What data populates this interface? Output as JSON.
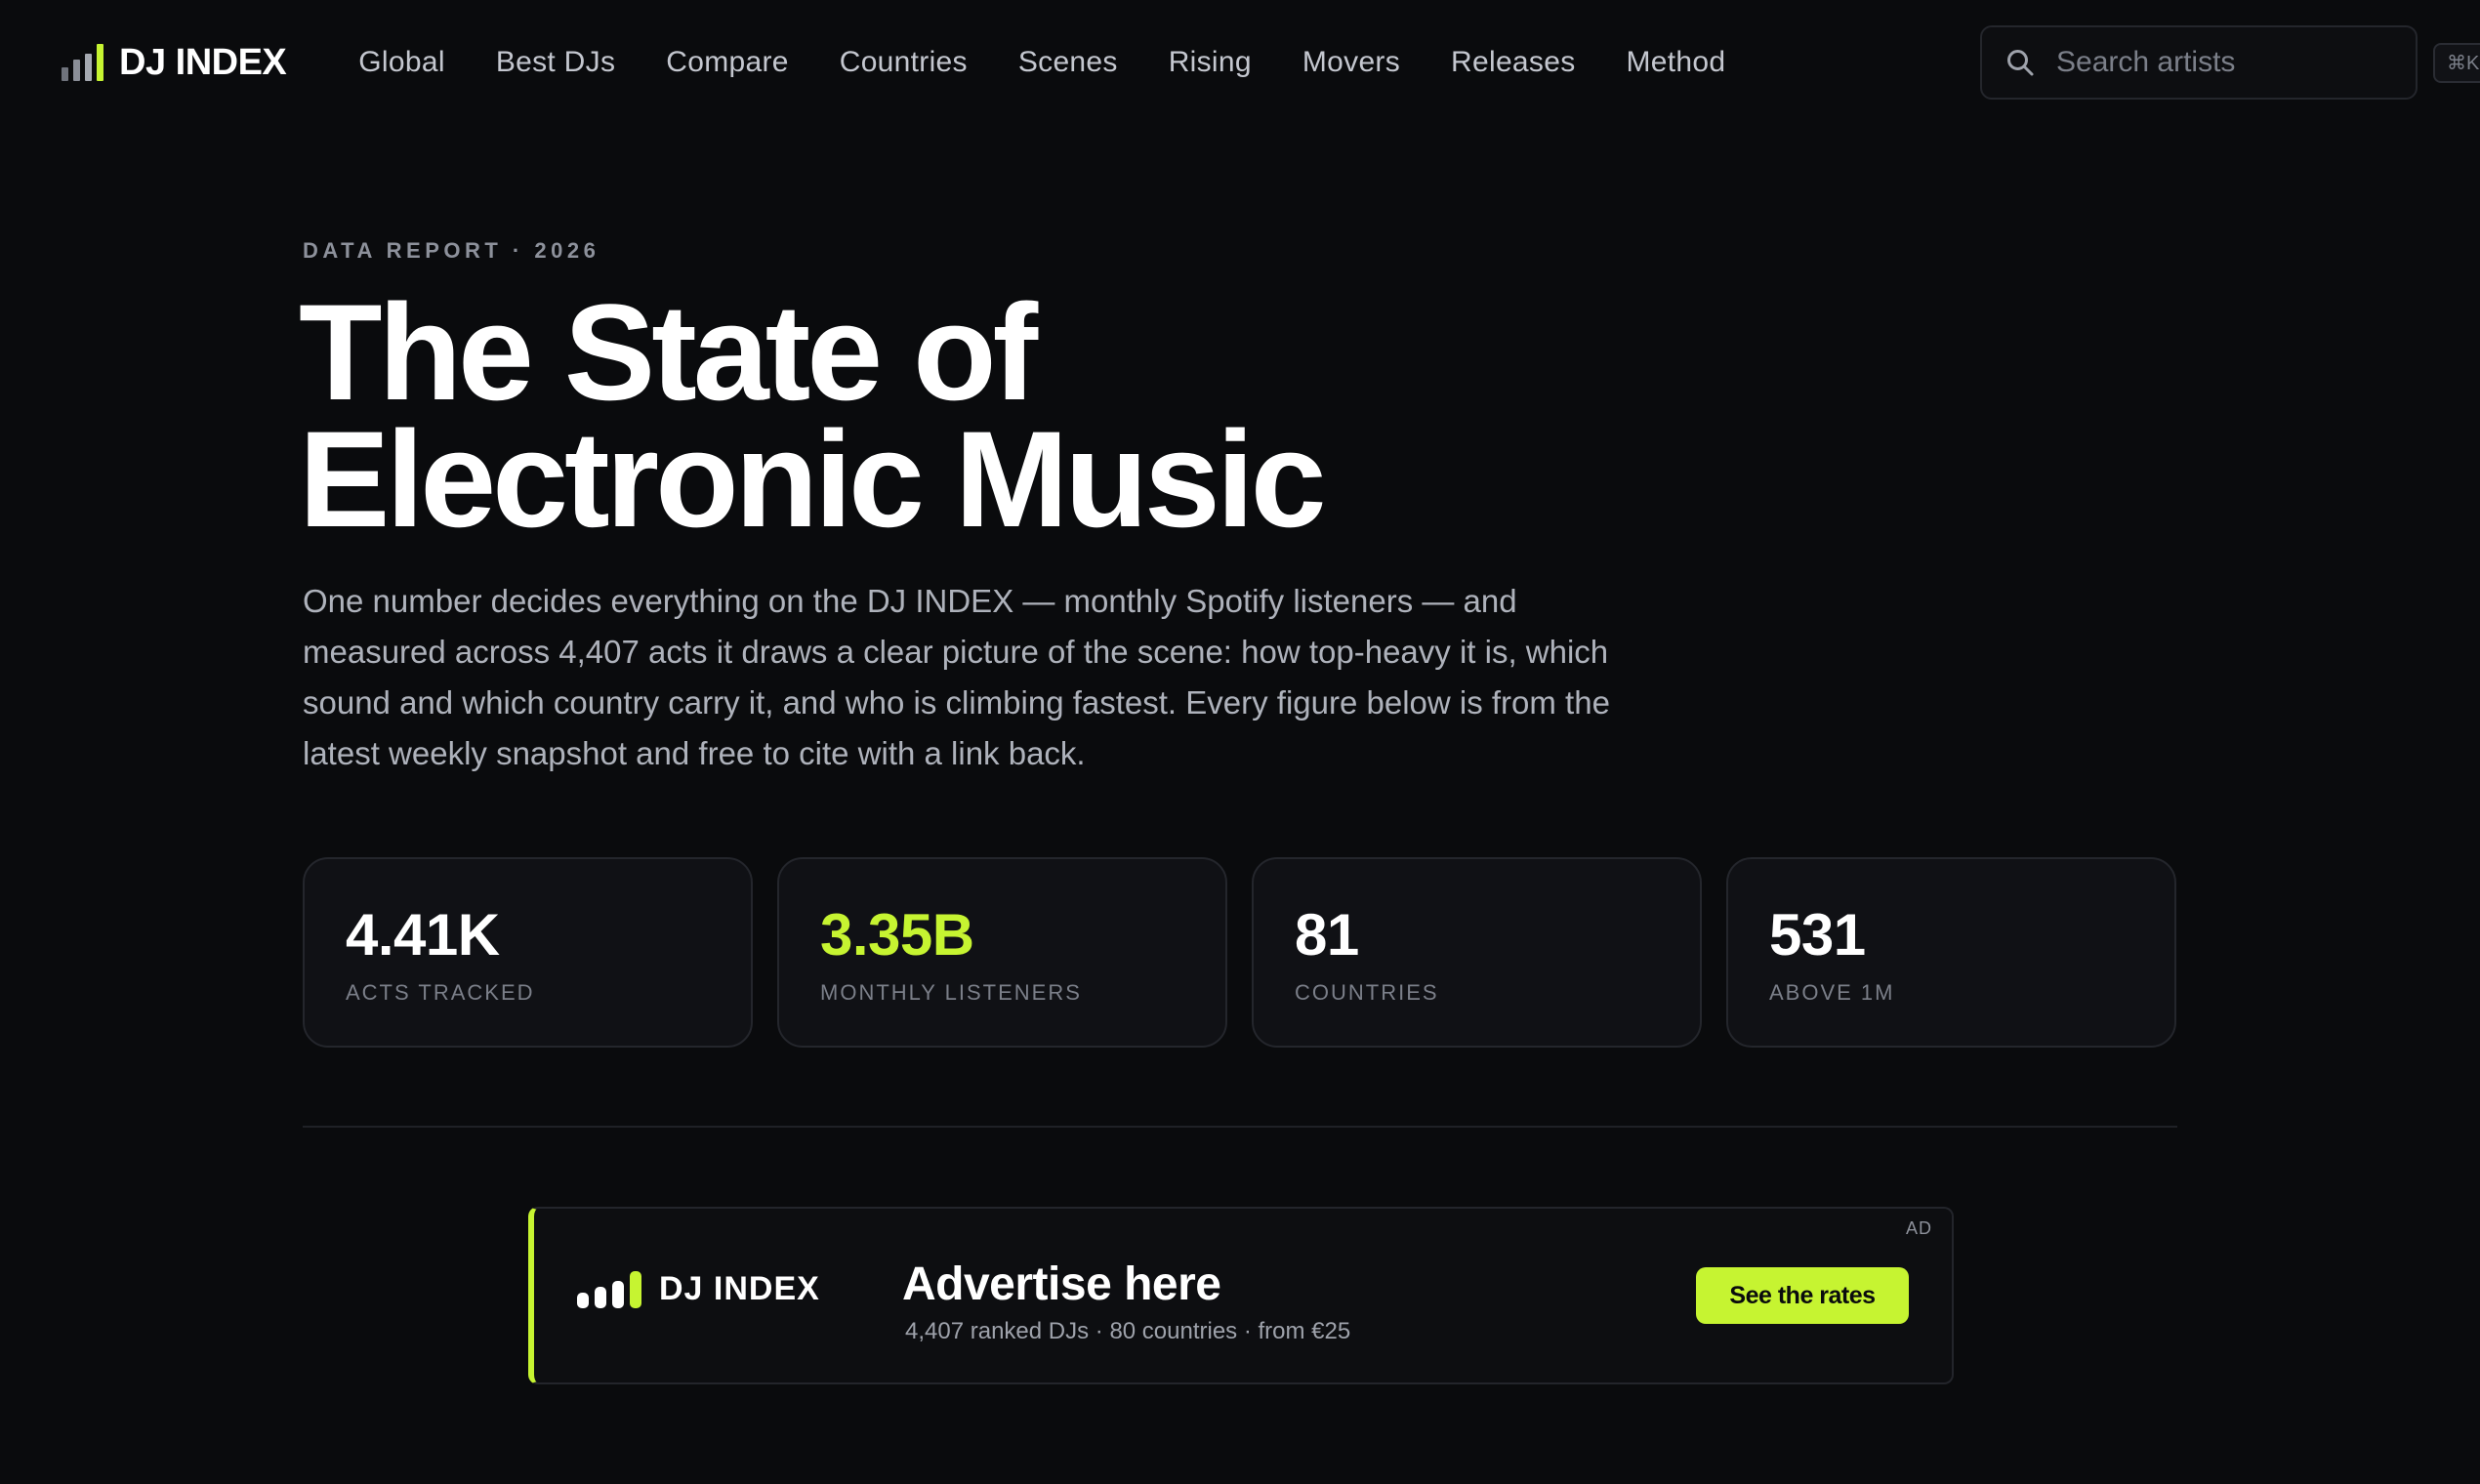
{
  "brand": {
    "name": "DJ INDEX",
    "accent_color": "#c6f431",
    "logo_icon": "bar-chart-icon"
  },
  "nav": {
    "items": [
      {
        "label": "Global"
      },
      {
        "label": "Best DJs"
      },
      {
        "label": "Compare"
      },
      {
        "label": "Countries"
      },
      {
        "label": "Scenes"
      },
      {
        "label": "Rising"
      },
      {
        "label": "Movers"
      },
      {
        "label": "Releases"
      },
      {
        "label": "Method"
      }
    ]
  },
  "search": {
    "placeholder": "Search artists",
    "shortcut": "⌘K",
    "icon": "search-icon"
  },
  "hero": {
    "eyebrow": "DATA REPORT · 2026",
    "title_line1": "The State of",
    "title_line2": "Electronic Music",
    "lede": "One number decides everything on the DJ INDEX — monthly Spotify listeners — and measured across 4,407 acts it draws a clear picture of the scene: how top-heavy it is, which sound and which country carry it, and who is climbing fastest. Every figure below is from the latest weekly snapshot and free to cite with a link back."
  },
  "stats": [
    {
      "value": "4.41K",
      "label": "ACTS TRACKED"
    },
    {
      "value": "3.35B",
      "label": "MONTHLY LISTENERS",
      "highlight": true
    },
    {
      "value": "81",
      "label": "COUNTRIES"
    },
    {
      "value": "531",
      "label": "ABOVE 1M"
    }
  ],
  "ad": {
    "tag": "AD",
    "brand_name": "DJ INDEX",
    "headline": "Advertise here",
    "subline": "4,407 ranked DJs · 80 countries · from €25",
    "cta_label": "See the rates"
  }
}
